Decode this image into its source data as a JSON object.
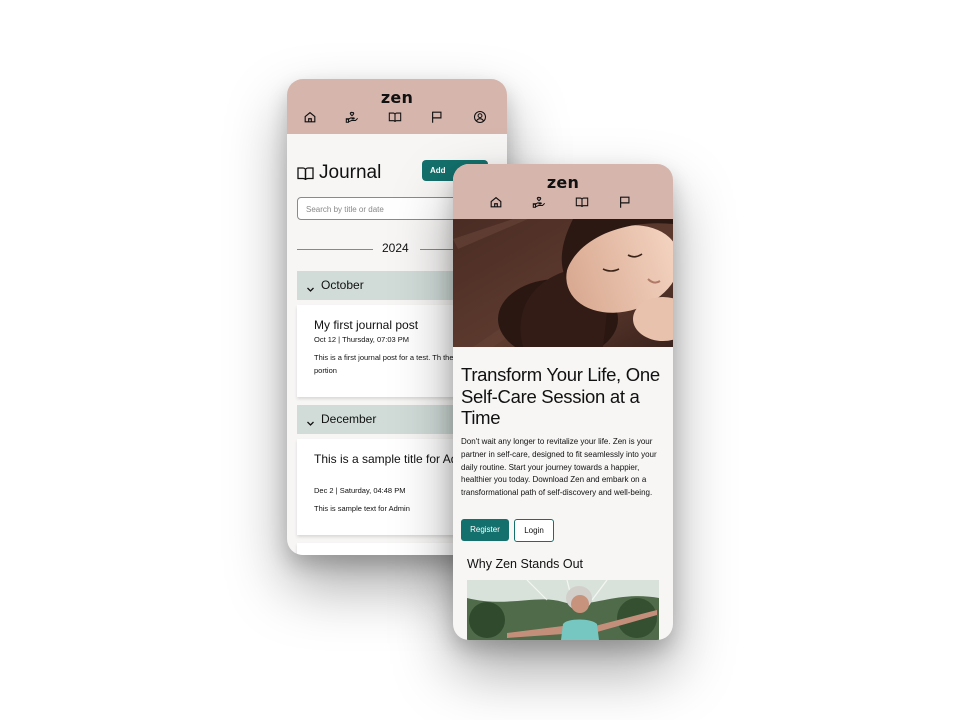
{
  "brand": "zen",
  "journal": {
    "title": "Journal",
    "add_button": "Add",
    "search_placeholder": "Search by title or date",
    "year": "2024",
    "groups": [
      {
        "month": "October",
        "entry": {
          "title": "My first journal post",
          "meta": "Oct 12 | Thursday, 07:03 PM",
          "body": "This is a first journal post for a test. Th the message portion"
        }
      },
      {
        "month": "December",
        "entry": {
          "title": "This is a sample title for Admin.",
          "meta": "Dec 2 | Saturday, 04:48 PM",
          "body": "This is sample text for Admin"
        }
      }
    ]
  },
  "home": {
    "headline": "Transform Your Life, One Self-Care Session at a Time",
    "intro": "Don't wait any longer to revitalize your life. Zen is your partner in self-care, designed to fit seamlessly into your daily routine. Start your journey towards a happier, healthier you today. Download Zen and embark on a transformational path of self-discovery and well-being.",
    "register_label": "Register",
    "login_label": "Login",
    "section_title": "Why Zen Stands Out"
  },
  "nav_icons_journal": [
    "home-icon",
    "hand-heart-icon",
    "book-icon",
    "flag-icon",
    "user-icon"
  ],
  "nav_icons_home": [
    "home-icon",
    "hand-heart-icon",
    "book-icon",
    "flag-icon"
  ],
  "colors": {
    "header_bg": "#d6b5ad",
    "accent": "#14706c",
    "month_bar": "#d1dcd9",
    "page_bg": "#f7f6f5"
  }
}
